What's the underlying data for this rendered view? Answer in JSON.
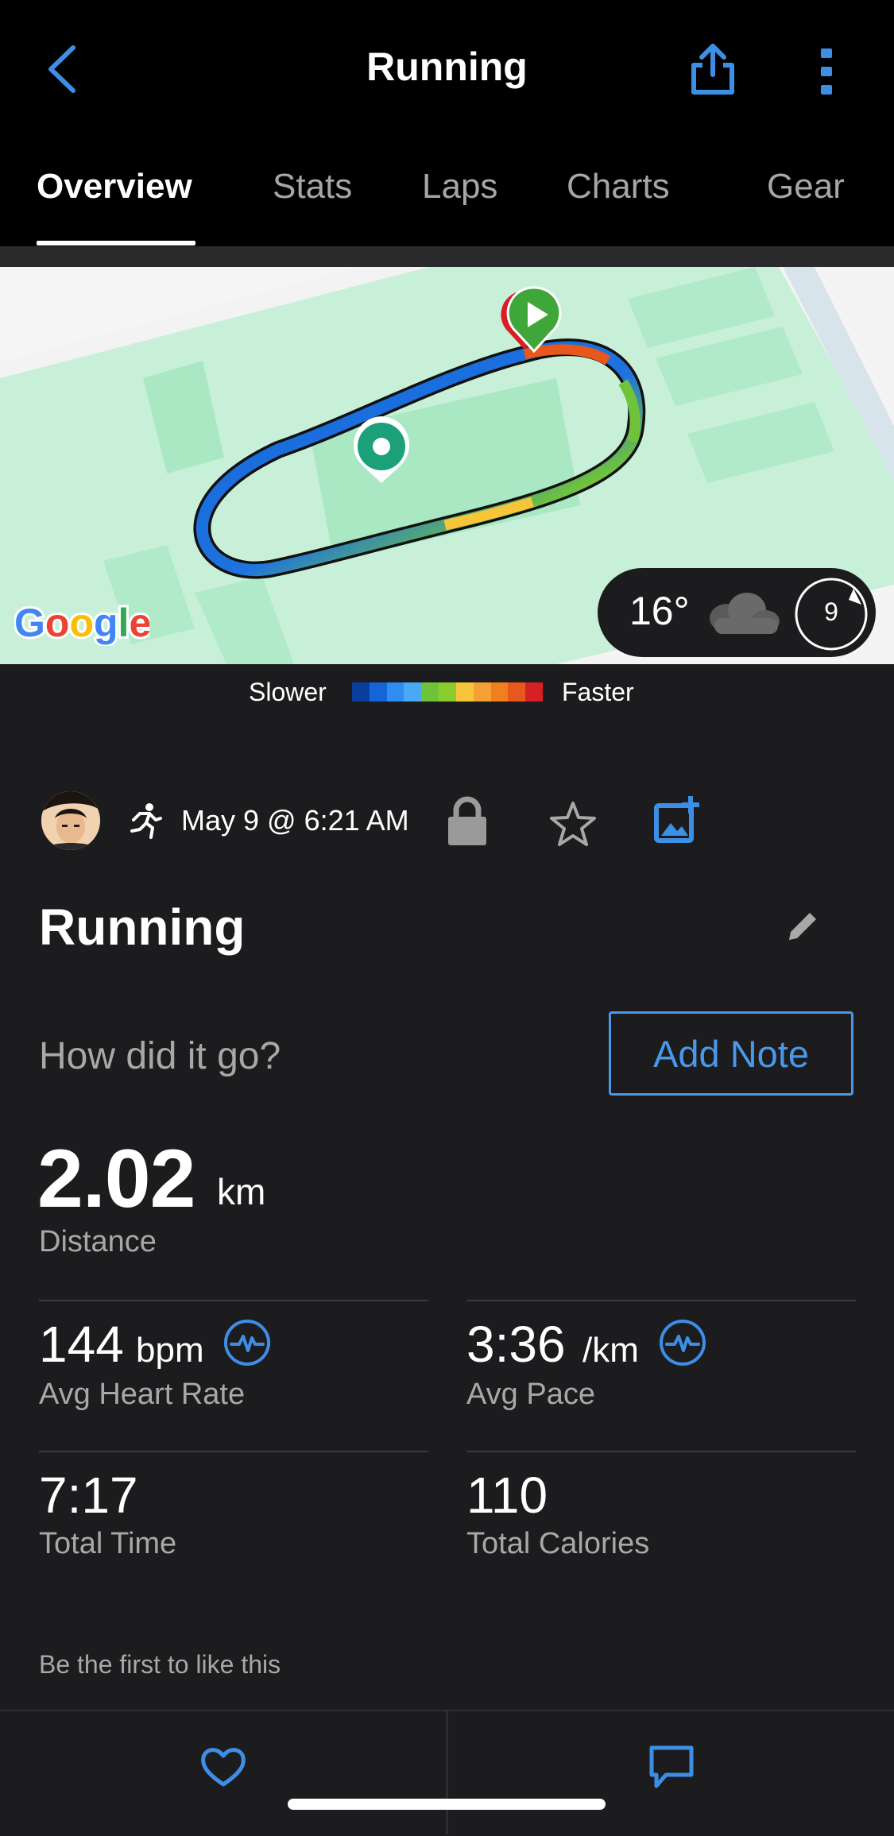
{
  "header": {
    "title": "Running",
    "tabs": [
      {
        "label": "Overview"
      },
      {
        "label": "Stats"
      },
      {
        "label": "Laps"
      },
      {
        "label": "Charts"
      },
      {
        "label": "Gear"
      }
    ],
    "active_tab": "Overview"
  },
  "map": {
    "attribution": "Google",
    "weather": {
      "temperature": "16°",
      "wind_value": "9"
    },
    "legend": {
      "slower_label": "Slower",
      "faster_label": "Faster",
      "colors": [
        "#0a3d9c",
        "#1565d8",
        "#2f8cf0",
        "#4aa8f5",
        "#6fc33b",
        "#8bcd2e",
        "#f7c53a",
        "#f5a032",
        "#f07f1d",
        "#e8581c",
        "#d71f26"
      ]
    }
  },
  "activity": {
    "date": "May 9 @ 6:21 AM",
    "name": "Running",
    "prompt": "How did it go?",
    "add_note_label": "Add Note"
  },
  "stats": {
    "distance": {
      "value": "2.02",
      "unit": "km",
      "label": "Distance"
    },
    "heart_rate": {
      "value": "144",
      "unit": "bpm",
      "label": "Avg Heart Rate"
    },
    "pace": {
      "value": "3:36",
      "unit": "/km",
      "label": "Avg Pace"
    },
    "time": {
      "value": "7:17",
      "label": "Total Time"
    },
    "calories": {
      "value": "110",
      "label": "Total Calories"
    }
  },
  "social": {
    "likes_text": "Be the first to like this"
  },
  "colors": {
    "accent": "#4a98e8",
    "background": "#1c1c1e",
    "header": "#000000"
  }
}
